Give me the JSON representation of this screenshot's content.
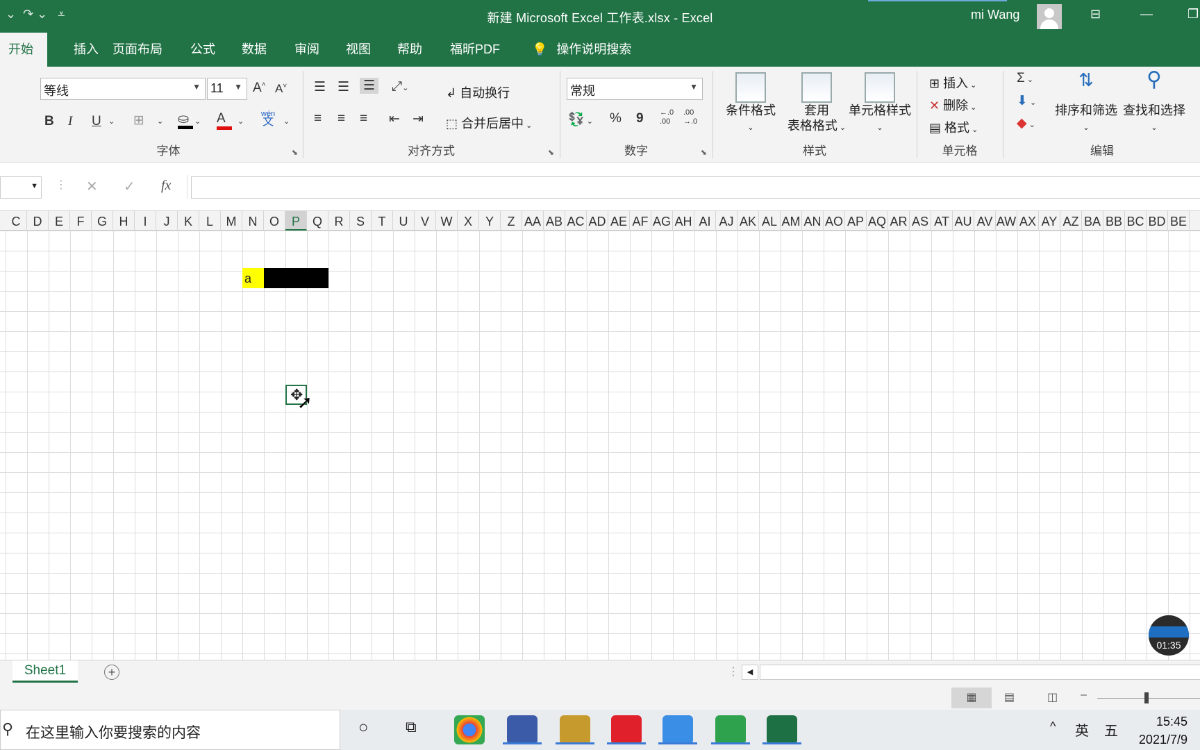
{
  "window": {
    "title": "新建 Microsoft Excel 工作表.xlsx  -  Excel",
    "user": "mi Wang"
  },
  "tabs": [
    "开始",
    "插入",
    "页面布局",
    "公式",
    "数据",
    "审阅",
    "视图",
    "帮助",
    "福昕PDF",
    "操作说明搜索"
  ],
  "font": {
    "name": "等线",
    "size": "11",
    "bold": "B",
    "italic": "I",
    "underline": "U",
    "phonetic": "wén",
    "group": "字体"
  },
  "alignment": {
    "wrap": "自动换行",
    "merge": "合并后居中",
    "group": "对齐方式"
  },
  "number": {
    "format": "常规",
    "percent": "%",
    "comma": "9",
    "group": "数字",
    "inc": "←.0 .00",
    "dec": ".00 →.0"
  },
  "styles": {
    "conditional": "条件格式",
    "table_line1": "套用",
    "table_line2": "表格格式",
    "cell_styles": "单元格样式",
    "group": "样式"
  },
  "cells_group": {
    "insert": "插入",
    "delete": "删除",
    "format": "格式",
    "group": "单元格"
  },
  "editing": {
    "sort": "排序和筛选",
    "find": "查找和选择",
    "group": "编辑"
  },
  "formula": {
    "fx": "fx",
    "value": ""
  },
  "columns": [
    "C",
    "D",
    "E",
    "F",
    "G",
    "H",
    "I",
    "J",
    "K",
    "L",
    "M",
    "N",
    "O",
    "P",
    "Q",
    "R",
    "S",
    "T",
    "U",
    "V",
    "W",
    "X",
    "Y",
    "Z",
    "AA",
    "AB",
    "AC",
    "AD",
    "AE",
    "AF",
    "AG",
    "AH",
    "AI",
    "AJ",
    "AK",
    "AL",
    "AM",
    "AN",
    "AO",
    "AP",
    "AQ",
    "AR",
    "AS",
    "AT",
    "AU",
    "AV",
    "AW",
    "AX",
    "AY",
    "AZ",
    "BA",
    "BB",
    "BC",
    "BD",
    "BE"
  ],
  "selected_column": "P",
  "cell_a": "a",
  "sheet": {
    "name": "Sheet1"
  },
  "timer": "01:35",
  "taskbar": {
    "search_placeholder": "在这里输入你要搜索的内容",
    "ime1": "英",
    "ime2": "五",
    "time": "15:45",
    "date": "2021/7/9"
  },
  "colors": {
    "accent": "#217346",
    "highlight": "#ffff00",
    "fill_black": "#000000"
  }
}
